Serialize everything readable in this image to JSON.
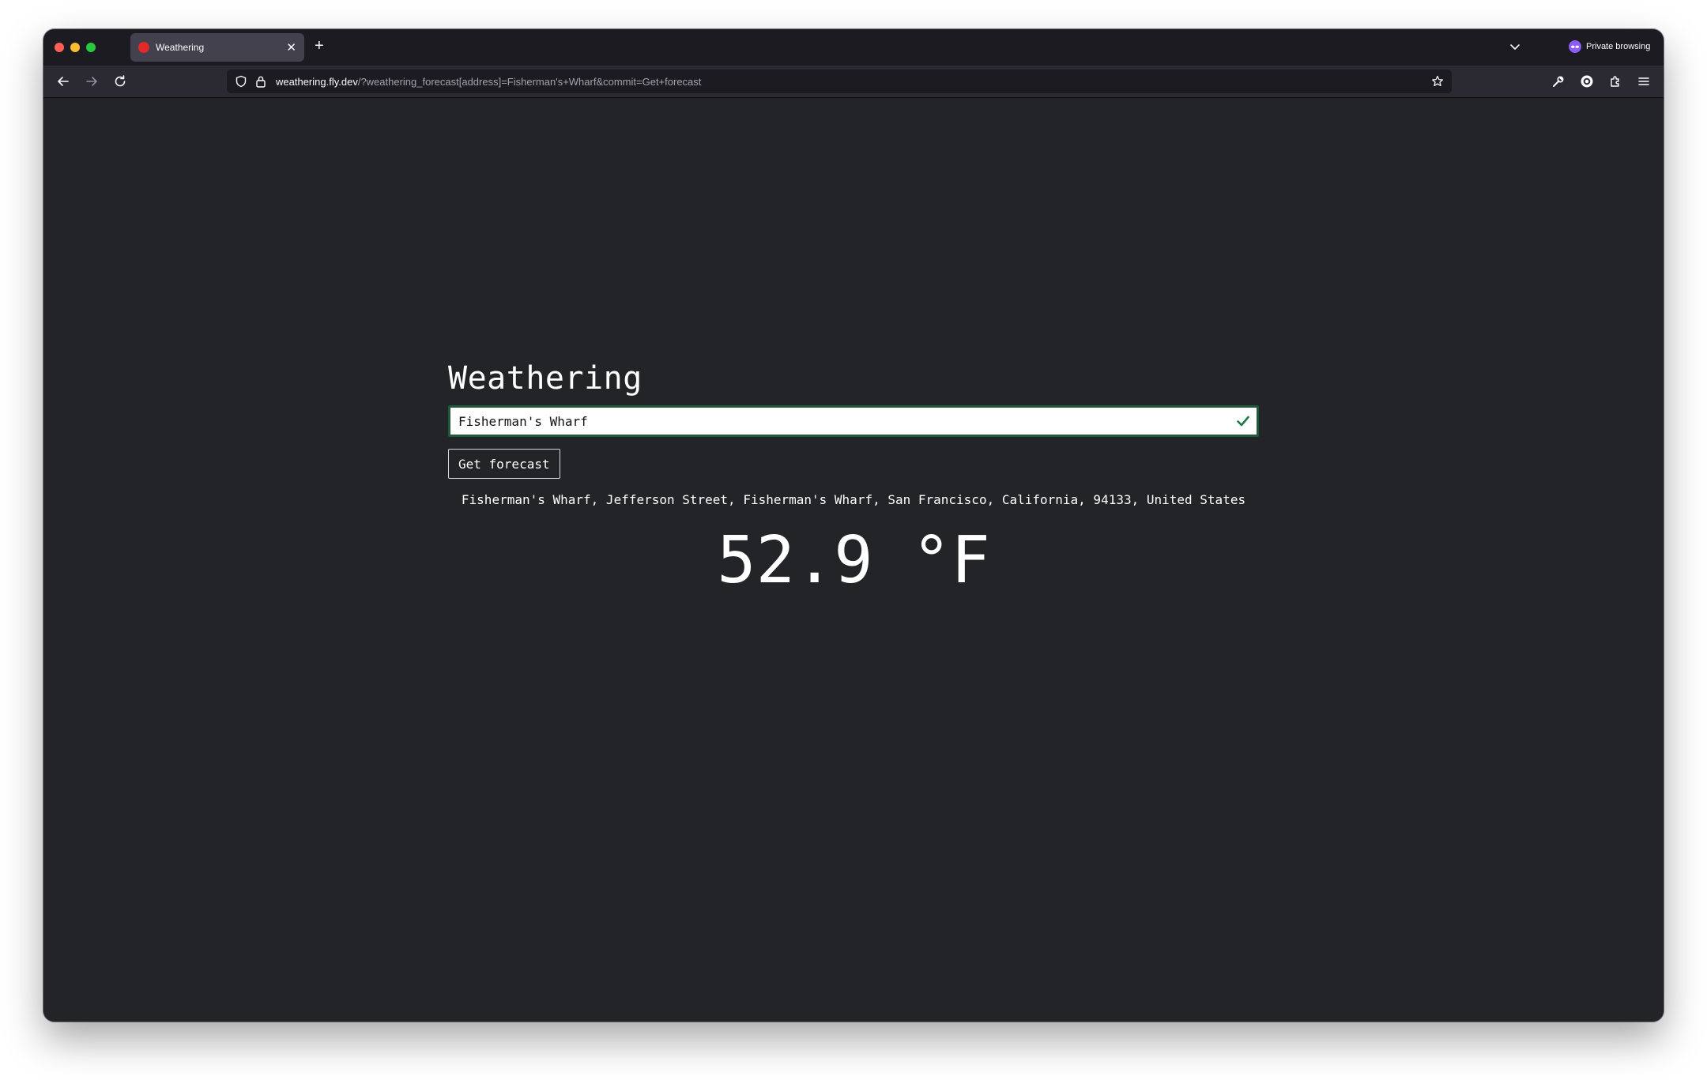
{
  "browser": {
    "tab": {
      "title": "Weathering",
      "favicon_color": "#e22828"
    },
    "private_label": "Private browsing",
    "url": {
      "host": "weathering.fly.dev",
      "path": "/?weathering_forecast[address]=Fisherman's+Wharf&commit=Get+forecast"
    },
    "icons": {
      "back": "back-arrow-icon",
      "forward": "forward-arrow-icon",
      "reload": "reload-icon",
      "shield": "shield-icon",
      "lock": "lock-icon",
      "star": "star-icon",
      "wrench": "wrench-icon",
      "account": "account-icon",
      "extensions": "extensions-icon",
      "menu": "hamburger-menu-icon"
    }
  },
  "page": {
    "title": "Weathering",
    "search": {
      "value": "Fisherman's Wharf"
    },
    "submit_label": "Get forecast",
    "address": "Fisherman's Wharf, Jefferson Street, Fisherman's Wharf, San Francisco, California, 94133, United States",
    "temperature": "52.9 °F"
  },
  "colors": {
    "page_background": "#222427",
    "input_border": "#1f5a3b",
    "valid_check": "#1f7a4a"
  }
}
